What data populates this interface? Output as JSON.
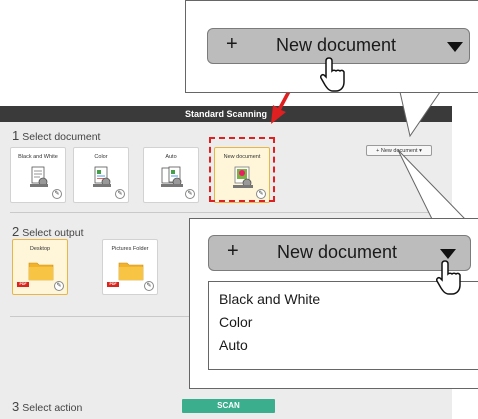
{
  "window": {
    "title": "Standard Scanning"
  },
  "sections": {
    "document": {
      "number": "1",
      "title": "Select document",
      "tiles": [
        {
          "label": "Black and White"
        },
        {
          "label": "Color"
        },
        {
          "label": "Auto"
        },
        {
          "label": "New document"
        }
      ],
      "dropdown_label": "+ New document ▾"
    },
    "output": {
      "number": "2",
      "title": "Select output",
      "tiles": [
        {
          "label": "Desktop",
          "badge": "PDF"
        },
        {
          "label": "Pictures Folder",
          "badge": "PDF"
        }
      ]
    },
    "action": {
      "number": "3",
      "title": "Select action",
      "scan_label": "SCAN"
    }
  },
  "callout_top": {
    "plus": "+",
    "label": "New document"
  },
  "callout_menu": {
    "plus": "+",
    "label": "New document",
    "items": [
      "Black and White",
      "Color",
      "Auto"
    ]
  },
  "colors": {
    "accent_scan": "#3aae8d",
    "highlight_red": "#e02020",
    "selected_tile": "#fff6d9"
  },
  "icons": [
    "pencil-icon",
    "folder-icon",
    "scanner-document-icon",
    "mouse-cursor-icon",
    "dropdown-triangle-icon",
    "arrow-icon"
  ]
}
